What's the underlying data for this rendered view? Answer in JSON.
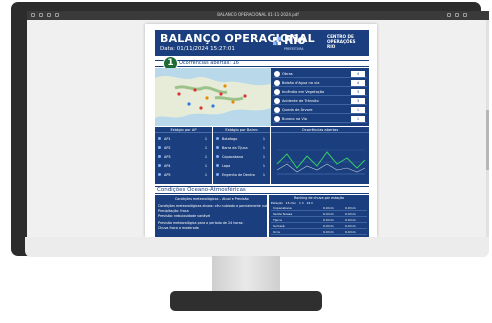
{
  "viewer": {
    "title": "BALANCO OPERACIONAL 01-11-2024.pdf"
  },
  "report": {
    "title": "BALANÇO OPERACIONAL",
    "date": "Data: 01/11/2024 15:27:01",
    "logo_word": "Rio",
    "logo_sub": "PREFEITURA",
    "center_name": "CENTRO DE\nOPERAÇÕES\nRIO",
    "badge": "1",
    "occurrences_heading": "Ocorrências abertas: 16"
  },
  "occurrences": [
    {
      "label": "Obras",
      "count": "4"
    },
    {
      "label": "Bolsão d'água na via",
      "count": "4"
    },
    {
      "label": "Incêndio em Vegetação",
      "count": "3"
    },
    {
      "label": "Acidente de Trânsito",
      "count": "3"
    },
    {
      "label": "Queda de Árvore",
      "count": "1"
    },
    {
      "label": "Buraco na Via",
      "count": "1"
    }
  ],
  "stages": {
    "heading": "Estágio por AP",
    "items": [
      {
        "label": "AP1",
        "value": "1"
      },
      {
        "label": "AP2",
        "value": "1"
      },
      {
        "label": "AP3",
        "value": "1"
      },
      {
        "label": "AP4",
        "value": "1"
      },
      {
        "label": "AP5",
        "value": "1"
      }
    ]
  },
  "by_district": {
    "heading": "Estágio por Bairro",
    "items": [
      {
        "label": "Botafogo",
        "value": "1"
      },
      {
        "label": "Barra da Tijuca",
        "value": "1"
      },
      {
        "label": "Copacabana",
        "value": "1"
      },
      {
        "label": "Lapa",
        "value": "1"
      },
      {
        "label": "Engenho de Dentro",
        "value": "1"
      }
    ]
  },
  "chart_panel": {
    "heading": "Ocorrências abertas",
    "legend": "Ocorrências"
  },
  "conditions": {
    "heading": "Condições Oceano-Atmosféricas",
    "weather_heading": "Condições meteorológicas – Atual e Previsão",
    "lines": [
      "Condições meteorológicas atuais: céu nublado a parcialmente nublado",
      "Precipitação: fraca",
      "Previsão: nebulosidade variável",
      "Previsão meteorológica para o período de 24 horas:",
      "Chuva fraca a moderada"
    ]
  },
  "rain": {
    "heading": "Ranking de chuva por estação",
    "columns": [
      "Estação",
      "15 min",
      "1 h",
      "24 h"
    ],
    "rows": [
      {
        "name": "Copacabana",
        "v1": "0.0mm",
        "v2": "0.0mm"
      },
      {
        "name": "Santa Teresa",
        "v1": "0.0mm",
        "v2": "0.0mm"
      },
      {
        "name": "Tijuca",
        "v1": "0.0mm",
        "v2": "0.0mm"
      },
      {
        "name": "Sumaré",
        "v1": "0.0mm",
        "v2": "0.0mm"
      },
      {
        "name": "Urca",
        "v1": "0.0mm",
        "v2": "0.0mm"
      }
    ]
  },
  "colors": {
    "brand_blue": "#1b3f7e",
    "badge_green": "#1d6b33",
    "line_green": "#33cc66",
    "monitor": "#2c2c2c"
  }
}
